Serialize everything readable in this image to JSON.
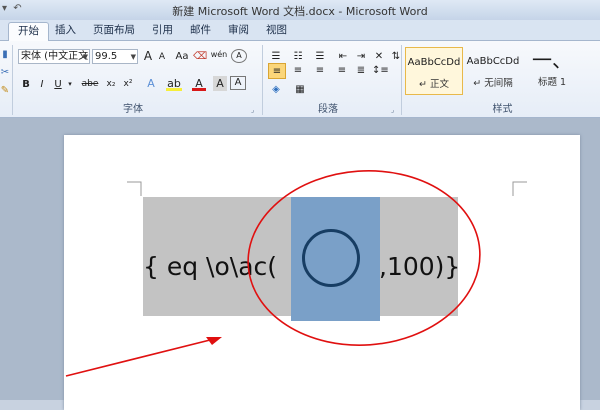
{
  "window": {
    "title": "新建 Microsoft Word 文档.docx - Microsoft Word"
  },
  "tabs": [
    {
      "label": "开始",
      "active": true
    },
    {
      "label": "插入"
    },
    {
      "label": "页面布局"
    },
    {
      "label": "引用"
    },
    {
      "label": "邮件"
    },
    {
      "label": "审阅"
    },
    {
      "label": "视图"
    }
  ],
  "font_group": {
    "label": "字体",
    "font_name": "宋体 (中文正文",
    "font_size": "99.5",
    "bold": "B",
    "italic": "I",
    "underline": "U",
    "strike": "abe",
    "subscript": "x₂",
    "superscript": "x²",
    "clear": "Aa",
    "font_color": "A",
    "phonetic": "wén",
    "enclose": "A",
    "grow": "A",
    "shrink": "A",
    "text_effect": "A"
  },
  "paragraph_group": {
    "label": "段落"
  },
  "styles_group": {
    "label": "样式",
    "items": [
      {
        "preview": "AaBbCcDd",
        "name": "↵ 正文",
        "selected": true
      },
      {
        "preview": "AaBbCcDd",
        "name": "↵ 无间隔"
      },
      {
        "preview": "一、",
        "name": "标题 1"
      }
    ]
  },
  "document": {
    "field_code_left": "{  eq \\o\\ac(",
    "field_code_right": ",100)}"
  },
  "colors": {
    "annotation": "#e01010",
    "field_shading": "#c3c3c3",
    "selection": "#7aa0c8"
  }
}
